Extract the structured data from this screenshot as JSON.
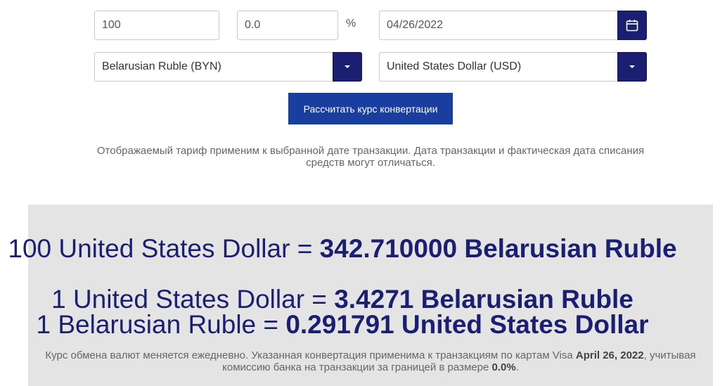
{
  "form": {
    "amount_value": "100",
    "fee_value": "0.0",
    "percent_symbol": "%",
    "date_value": "04/26/2022",
    "from_currency": "Belarusian Ruble (BYN)",
    "to_currency": "United States Dollar (USD)",
    "convert_button_label": "Рассчитать курс конвертации",
    "note": "Отображаемый тариф применим к выбранной дате транзакции. Дата транзакции и фактическая дата списания средств могут отличаться."
  },
  "result": {
    "line1_prefix": "100 United States Dollar = ",
    "line1_value": "342.710000 Belarusian Ruble",
    "line2_prefix": "1 United States Dollar = ",
    "line2_value": "3.4271 Belarusian Ruble",
    "line3_prefix": "1 Belarusian Ruble = ",
    "line3_value": "0.291791 United States Dollar",
    "footnote_part1": "Курс обмена валют меняется ежедневно. Указанная конвертация применима к транзакциям по картам Visa ",
    "footnote_date": "April 26, 2022",
    "footnote_part2": ", учитывая",
    "footnote_part3": "комиссию банка на транзакции за границей в размере ",
    "footnote_fee": "0.0%",
    "footnote_end": "."
  },
  "colors": {
    "navy": "#1a1f71",
    "button_blue": "#1a3e9f",
    "panel_gray": "#e4e4e4"
  },
  "icons": {
    "calendar": "calendar-icon",
    "dropdown": "caret-down-icon"
  }
}
